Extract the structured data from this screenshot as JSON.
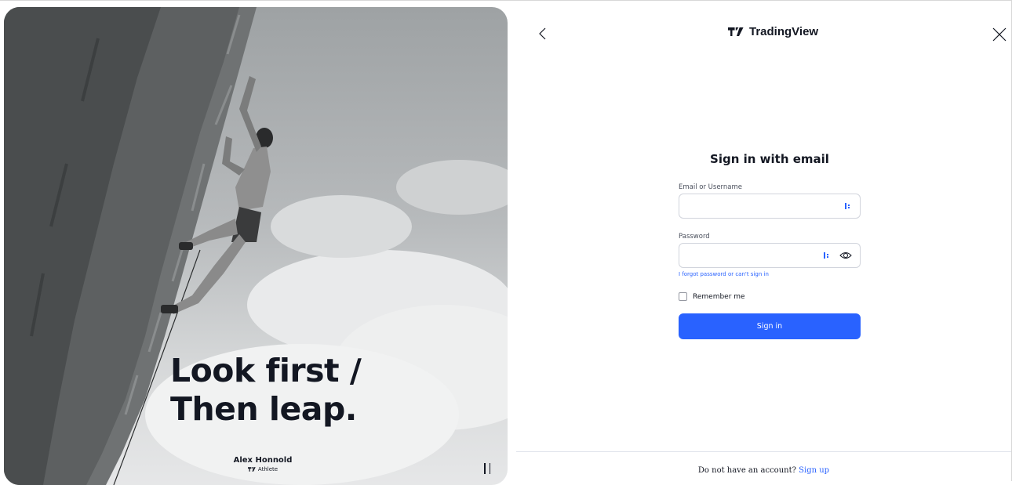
{
  "hero": {
    "headline_line1": "Look first /",
    "headline_line2": "Then leap.",
    "athlete_name": "Alex Honnold",
    "athlete_role": "Athlete"
  },
  "header": {
    "brand_name": "TradingView"
  },
  "form": {
    "title": "Sign in with email",
    "email_label": "Email or Username",
    "email_value": "",
    "password_label": "Password",
    "password_value": "",
    "forgot_link": "I forgot password or can't sign in",
    "remember_label": "Remember me",
    "remember_checked": false,
    "submit_label": "Sign in"
  },
  "footer": {
    "prompt": "Do not have an account?",
    "signup_link": "Sign up"
  },
  "colors": {
    "accent": "#2962ff",
    "text": "#131722"
  },
  "icons": [
    "back-arrow-icon",
    "close-icon",
    "tradingview-logo-icon",
    "password-manager-icon",
    "eye-icon",
    "pause-icon"
  ]
}
